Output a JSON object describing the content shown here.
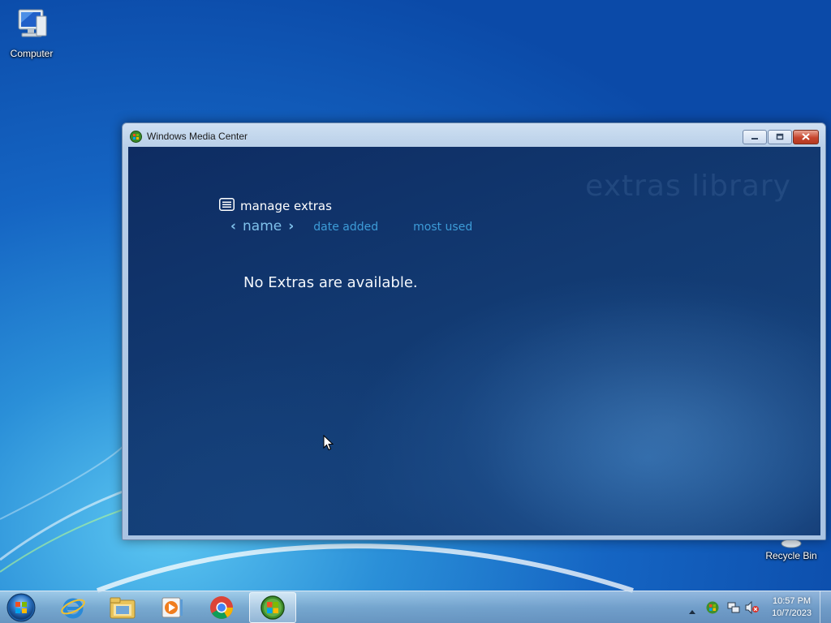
{
  "desktop": {
    "icons": [
      {
        "label": "Computer",
        "icon": "computer-icon"
      },
      {
        "label": "Recycle Bin",
        "icon": "recycle-bin-icon"
      }
    ]
  },
  "window": {
    "title": "Windows Media Center",
    "icon": "windows-media-center-icon",
    "buttons": {
      "minimize": "minimize-icon",
      "maximize": "restore-icon",
      "close": "close-icon"
    }
  },
  "wmc": {
    "background_title": "extras library",
    "header": "manage extras",
    "sort": {
      "active": "name",
      "options": [
        "date added",
        "most used"
      ]
    },
    "empty_message": "No Extras are available."
  },
  "taskbar": {
    "items": [
      "start-orb-icon",
      "internet-explorer-icon",
      "windows-explorer-icon",
      "windows-media-player-icon",
      "chrome-icon",
      "windows-media-center-icon"
    ],
    "tray": [
      "show-hidden-icons-arrow",
      "windows-media-center-tray-icon",
      "network-icon",
      "volume-muted-icon"
    ],
    "clock": {
      "time": "10:57 PM",
      "date": "10/7/2023"
    }
  },
  "colors": {
    "accent": "#7fc0ea",
    "sort_option": "#3d9cd8",
    "content_bg": "#123a72"
  }
}
